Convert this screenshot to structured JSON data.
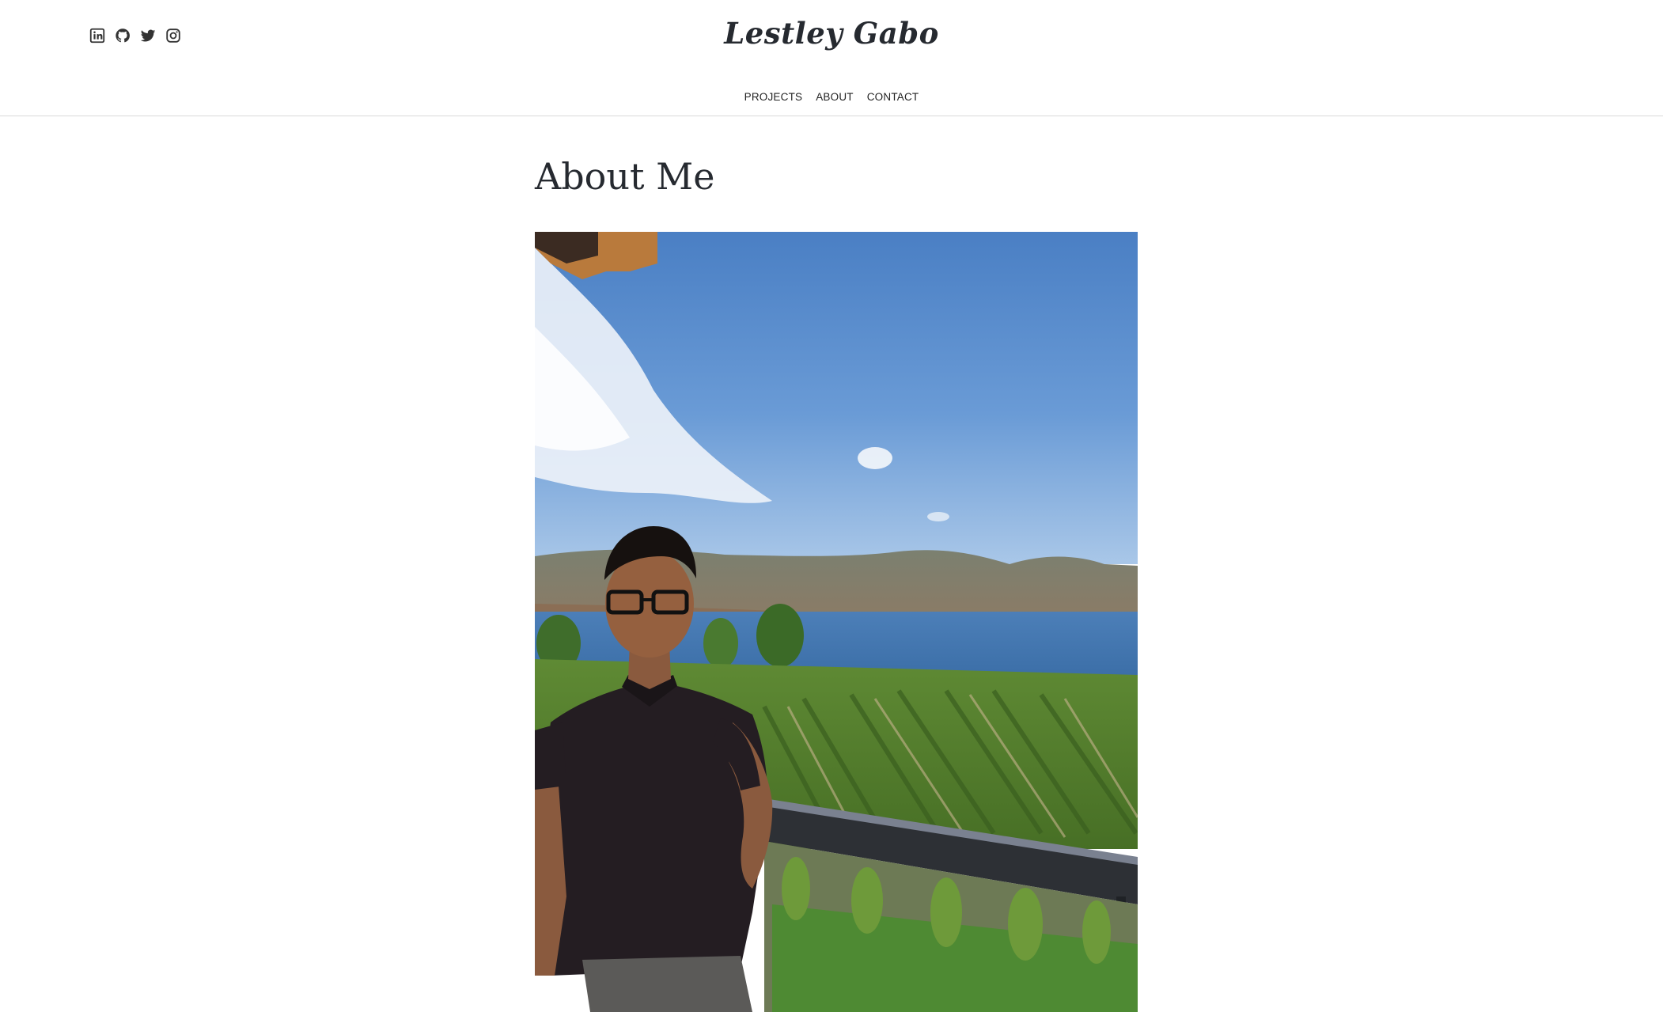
{
  "header": {
    "site_title": "Lestley Gabo",
    "social_links": [
      {
        "icon": "linkedin-icon"
      },
      {
        "icon": "github-icon"
      },
      {
        "icon": "twitter-icon"
      },
      {
        "icon": "instagram-icon"
      }
    ]
  },
  "nav": {
    "items": [
      {
        "label": "PROJECTS"
      },
      {
        "label": "ABOUT"
      },
      {
        "label": "CONTACT"
      }
    ]
  },
  "main": {
    "heading": "About Me",
    "photo": {
      "subject": "portrait-photo"
    }
  },
  "colors": {
    "text": "#262a30",
    "border": "#d9d9d9",
    "background": "#ffffff"
  }
}
